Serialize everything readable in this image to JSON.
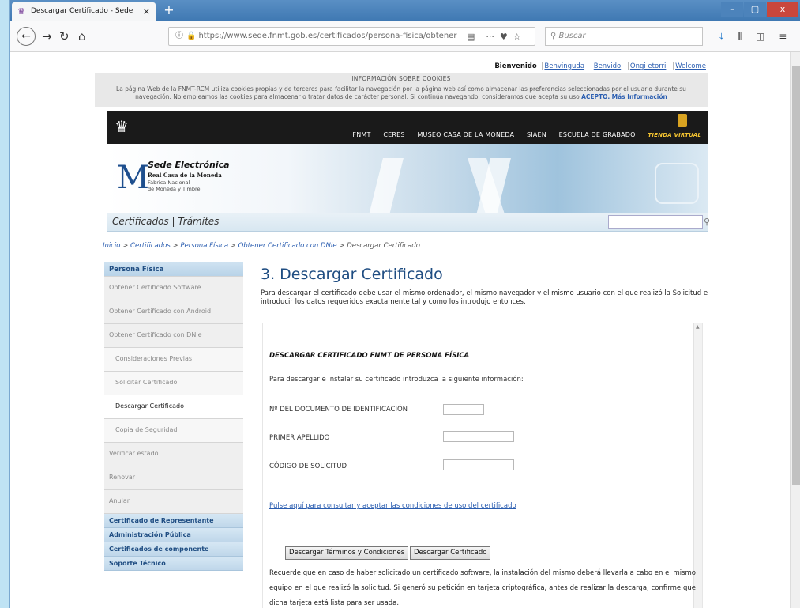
{
  "browser": {
    "tab_title": "Descargar Certificado - Sede",
    "tab_close": "×",
    "new_tab": "+",
    "url_host": "https://www.sede.fnmt.gob.es",
    "url_path": "/certificados/persona-fisica/obtener",
    "search_placeholder": "Buscar",
    "win_min": "–",
    "win_max": "▢",
    "win_close": "x"
  },
  "lang": {
    "welcome": "Bienvenido",
    "links": [
      "Benvinguda",
      "Benvido",
      "Ongi etorri",
      "Welcome"
    ]
  },
  "cookies": {
    "title": "INFORMACIÓN SOBRE COOKIES",
    "body": "La página Web de la FNMT-RCM utiliza cookies propias y de terceros para facilitar la navegación por la página web así como almacenar las preferencias seleccionadas por el usuario durante su navegación. No empleamos las cookies para almacenar o tratar datos de carácter personal. Si continúa navegando, consideramos que acepta su uso",
    "accept": "ACEPTO.",
    "more": "Más Información"
  },
  "topmenu": [
    "FNMT",
    "CERES",
    "MUSEO CASA DE LA MONEDA",
    "SIAEN",
    "ESCUELA DE GRABADO"
  ],
  "tienda": "TIENDA VIRTUAL",
  "banner": {
    "title": "Sede Electrónica",
    "line1": "Real Casa de la Moneda",
    "line2": "Fábrica Nacional",
    "line3": "de Moneda y Timbre"
  },
  "tabs": {
    "certificados": "Certificados",
    "sep": "|",
    "tramites": "Trámites"
  },
  "breadcrumb": [
    "Inicio",
    "Certificados",
    "Persona Física",
    "Obtener Certificado con DNIe",
    "Descargar Certificado"
  ],
  "sidebar": {
    "head": "Persona Física",
    "items": [
      {
        "label": "Obtener Certificado Software",
        "kind": "item"
      },
      {
        "label": "Obtener Certificado con Android",
        "kind": "item"
      },
      {
        "label": "Obtener Certificado con DNIe",
        "kind": "item"
      },
      {
        "label": "Consideraciones Previas",
        "kind": "sub"
      },
      {
        "label": "Solicitar Certificado",
        "kind": "sub"
      },
      {
        "label": "Descargar Certificado",
        "kind": "active"
      },
      {
        "label": "Copia de Seguridad",
        "kind": "sub"
      },
      {
        "label": "Verificar estado",
        "kind": "item"
      },
      {
        "label": "Renovar",
        "kind": "item"
      },
      {
        "label": "Anular",
        "kind": "item"
      }
    ],
    "categories": [
      "Certificado de Representante",
      "Administración Pública",
      "Certificados de componente",
      "Soporte Técnico"
    ]
  },
  "main": {
    "title": "3. Descargar Certificado",
    "intro": "Para descargar el certificado debe usar el mismo ordenador, el mismo navegador y el mismo usuario con el que realizó la Solicitud e introducir los datos requeridos exactamente tal y como los introdujo entonces.",
    "section_title": "DESCARGAR CERTIFICADO FNMT DE PERSONA FÍSICA",
    "help": "Para descargar e instalar su certificado introduzca la siguiente información:",
    "field_doc": "Nº DEL DOCUMENTO DE IDENTIFICACIÓN",
    "field_apellido": "PRIMER APELLIDO",
    "field_codigo": "CÓDIGO DE SOLICITUD",
    "doc_value": "",
    "apellido_value": "",
    "codigo_value": "",
    "conditions_link": "Pulse aquí para consultar y aceptar las condiciones de uso del certificado",
    "btn_terms": "Descargar Términos y Condiciones",
    "btn_download": "Descargar Certificado",
    "note": "Recuerde que en caso de haber solicitado un certificado software, la instalación del mismo deberá llevarla a cabo en el mismo equipo en el que realizó la solicitud. Si generó su petición en tarjeta criptográfica, antes de realizar la descarga, confirme que dicha tarjeta está lista para ser usada."
  }
}
